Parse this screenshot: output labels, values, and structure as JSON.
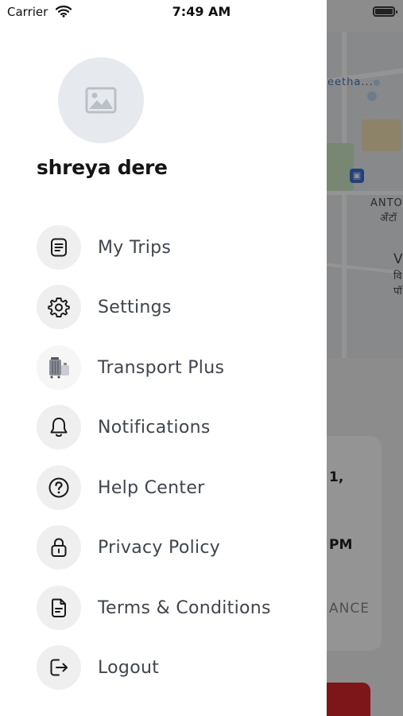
{
  "status_bar": {
    "carrier": "Carrier",
    "time": "7:49 AM"
  },
  "background": {
    "map_labels": [
      "eetha...",
      "ANTO",
      "अँटॉ",
      "V",
      "वि",
      "पॉ"
    ],
    "card_lines": [
      "1,",
      "PM",
      "ANCE"
    ]
  },
  "drawer": {
    "user_name": "shreya dere",
    "menu": [
      {
        "label": "My Trips",
        "icon": "document-list-icon"
      },
      {
        "label": "Settings",
        "icon": "gear-icon"
      },
      {
        "label": "Transport Plus",
        "icon": "luggage-icon"
      },
      {
        "label": "Notifications",
        "icon": "bell-icon"
      },
      {
        "label": "Help Center",
        "icon": "question-circle-icon"
      },
      {
        "label": "Privacy Policy",
        "icon": "lock-icon"
      },
      {
        "label": "Terms & Conditions",
        "icon": "file-text-icon"
      },
      {
        "label": "Logout",
        "icon": "logout-icon"
      }
    ]
  },
  "colors": {
    "accent": "#d7262b",
    "icon_bg": "#efefef",
    "label": "#3d4650"
  }
}
